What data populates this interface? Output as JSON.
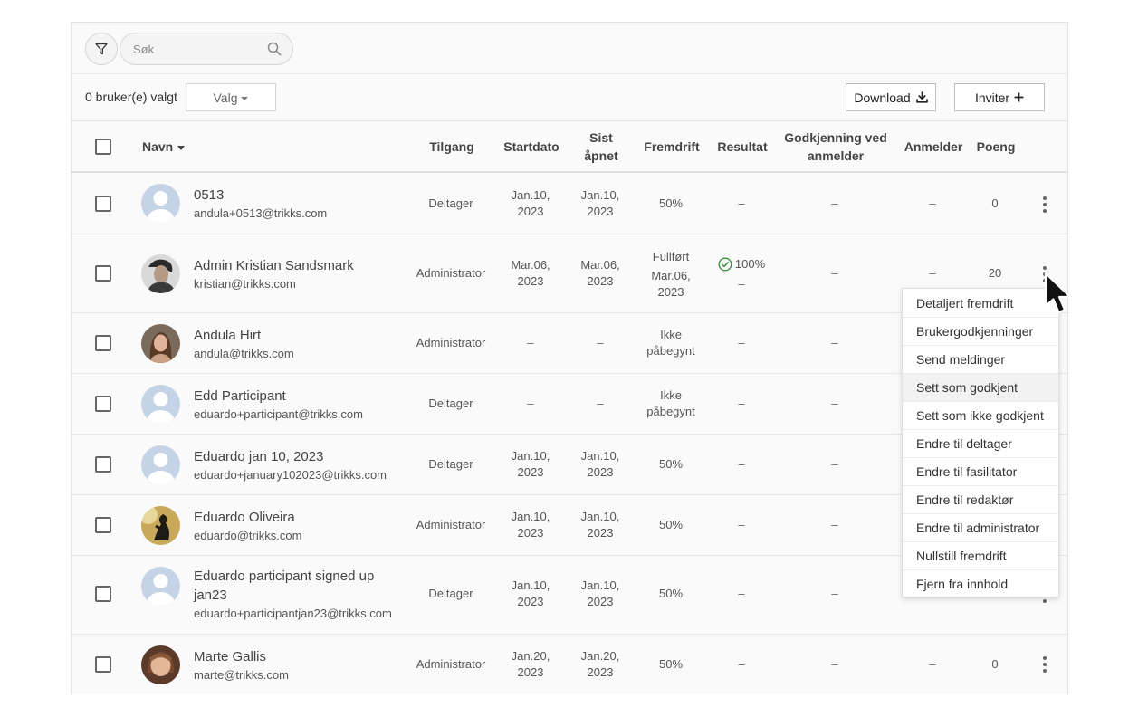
{
  "search": {
    "placeholder": "Søk",
    "value": ""
  },
  "toolbar": {
    "selected_count": "0 bruker(e) valgt",
    "valg_label": "Valg",
    "download_label": "Download",
    "invite_label": "Inviter"
  },
  "columns": {
    "name": "Navn",
    "access": "Tilgang",
    "start_date": "Startdato",
    "last_opened_1": "Sist",
    "last_opened_2": "åpnet",
    "progress": "Fremdrift",
    "result": "Resultat",
    "approval_1": "Godkjenning ved",
    "approval_2": "anmelder",
    "reviewer": "Anmelder",
    "points": "Poeng"
  },
  "rows": [
    {
      "name": "0513",
      "email": "andula+0513@trikks.com",
      "access": "Deltager",
      "start_1": "Jan.10,",
      "start_2": "2023",
      "opened_1": "Jan.10,",
      "opened_2": "2023",
      "progress": "50%",
      "result": "–",
      "approval": "–",
      "reviewer": "–",
      "points": "0"
    },
    {
      "name": "Admin Kristian Sandsmark",
      "email": "kristian@trikks.com",
      "access": "Administrator",
      "start_1": "Mar.06,",
      "start_2": "2023",
      "opened_1": "Mar.06,",
      "opened_2": "2023",
      "progress_1": "Fullført",
      "progress_2": "Mar.06,",
      "progress_3": "2023",
      "result": "100%",
      "result_sub": "–",
      "approval": "–",
      "reviewer": "–",
      "points": "20"
    },
    {
      "name": "Andula Hirt",
      "email": "andula@trikks.com",
      "access": "Administrator",
      "start": "–",
      "opened": "–",
      "progress_1": "Ikke",
      "progress_2": "påbegynt",
      "result": "–",
      "approval": "–"
    },
    {
      "name": "Edd Participant",
      "email": "eduardo+participant@trikks.com",
      "access": "Deltager",
      "start": "–",
      "opened": "–",
      "progress_1": "Ikke",
      "progress_2": "påbegynt",
      "result": "–",
      "approval": "–"
    },
    {
      "name": "Eduardo jan 10, 2023",
      "email": "eduardo+january102023@trikks.com",
      "access": "Deltager",
      "start_1": "Jan.10,",
      "start_2": "2023",
      "opened_1": "Jan.10,",
      "opened_2": "2023",
      "progress": "50%",
      "result": "–",
      "approval": "–"
    },
    {
      "name": "Eduardo Oliveira",
      "email": "eduardo@trikks.com",
      "access": "Administrator",
      "start_1": "Jan.10,",
      "start_2": "2023",
      "opened_1": "Jan.10,",
      "opened_2": "2023",
      "progress": "50%",
      "result": "–",
      "approval": "–"
    },
    {
      "name_1": "Eduardo participant signed up",
      "name_2": "jan23",
      "email": "eduardo+participantjan23@trikks.com",
      "access": "Deltager",
      "start_1": "Jan.10,",
      "start_2": "2023",
      "opened_1": "Jan.10,",
      "opened_2": "2023",
      "progress": "50%",
      "result": "–",
      "approval": "–"
    },
    {
      "name": "Marte Gallis",
      "email": "marte@trikks.com",
      "access": "Administrator",
      "start_1": "Jan.20,",
      "start_2": "2023",
      "opened_1": "Jan.20,",
      "opened_2": "2023",
      "progress": "50%",
      "result": "–",
      "approval": "–",
      "reviewer": "–",
      "points": "0"
    }
  ],
  "menu": {
    "items": [
      "Detaljert fremdrift",
      "Brukergodkjenninger",
      "Send meldinger",
      "Sett som godkjent",
      "Sett som ikke godkjent",
      "Endre til deltager",
      "Endre til fasilitator",
      "Endre til redaktør",
      "Endre til administrator",
      "Nullstill fremdrift",
      "Fjern fra innhold"
    ]
  },
  "icons": {
    "filter": "filter-icon",
    "search": "search-icon",
    "download": "download-icon",
    "invite": "plus-icon",
    "sort": "caret-down-icon",
    "more": "more-vertical-icon",
    "result_ok": "check-circle-icon",
    "cursor": "mouse-pointer-icon"
  },
  "colors": {
    "success": "#3a8f3a",
    "avatar_placeholder": "#c5d3e6"
  }
}
